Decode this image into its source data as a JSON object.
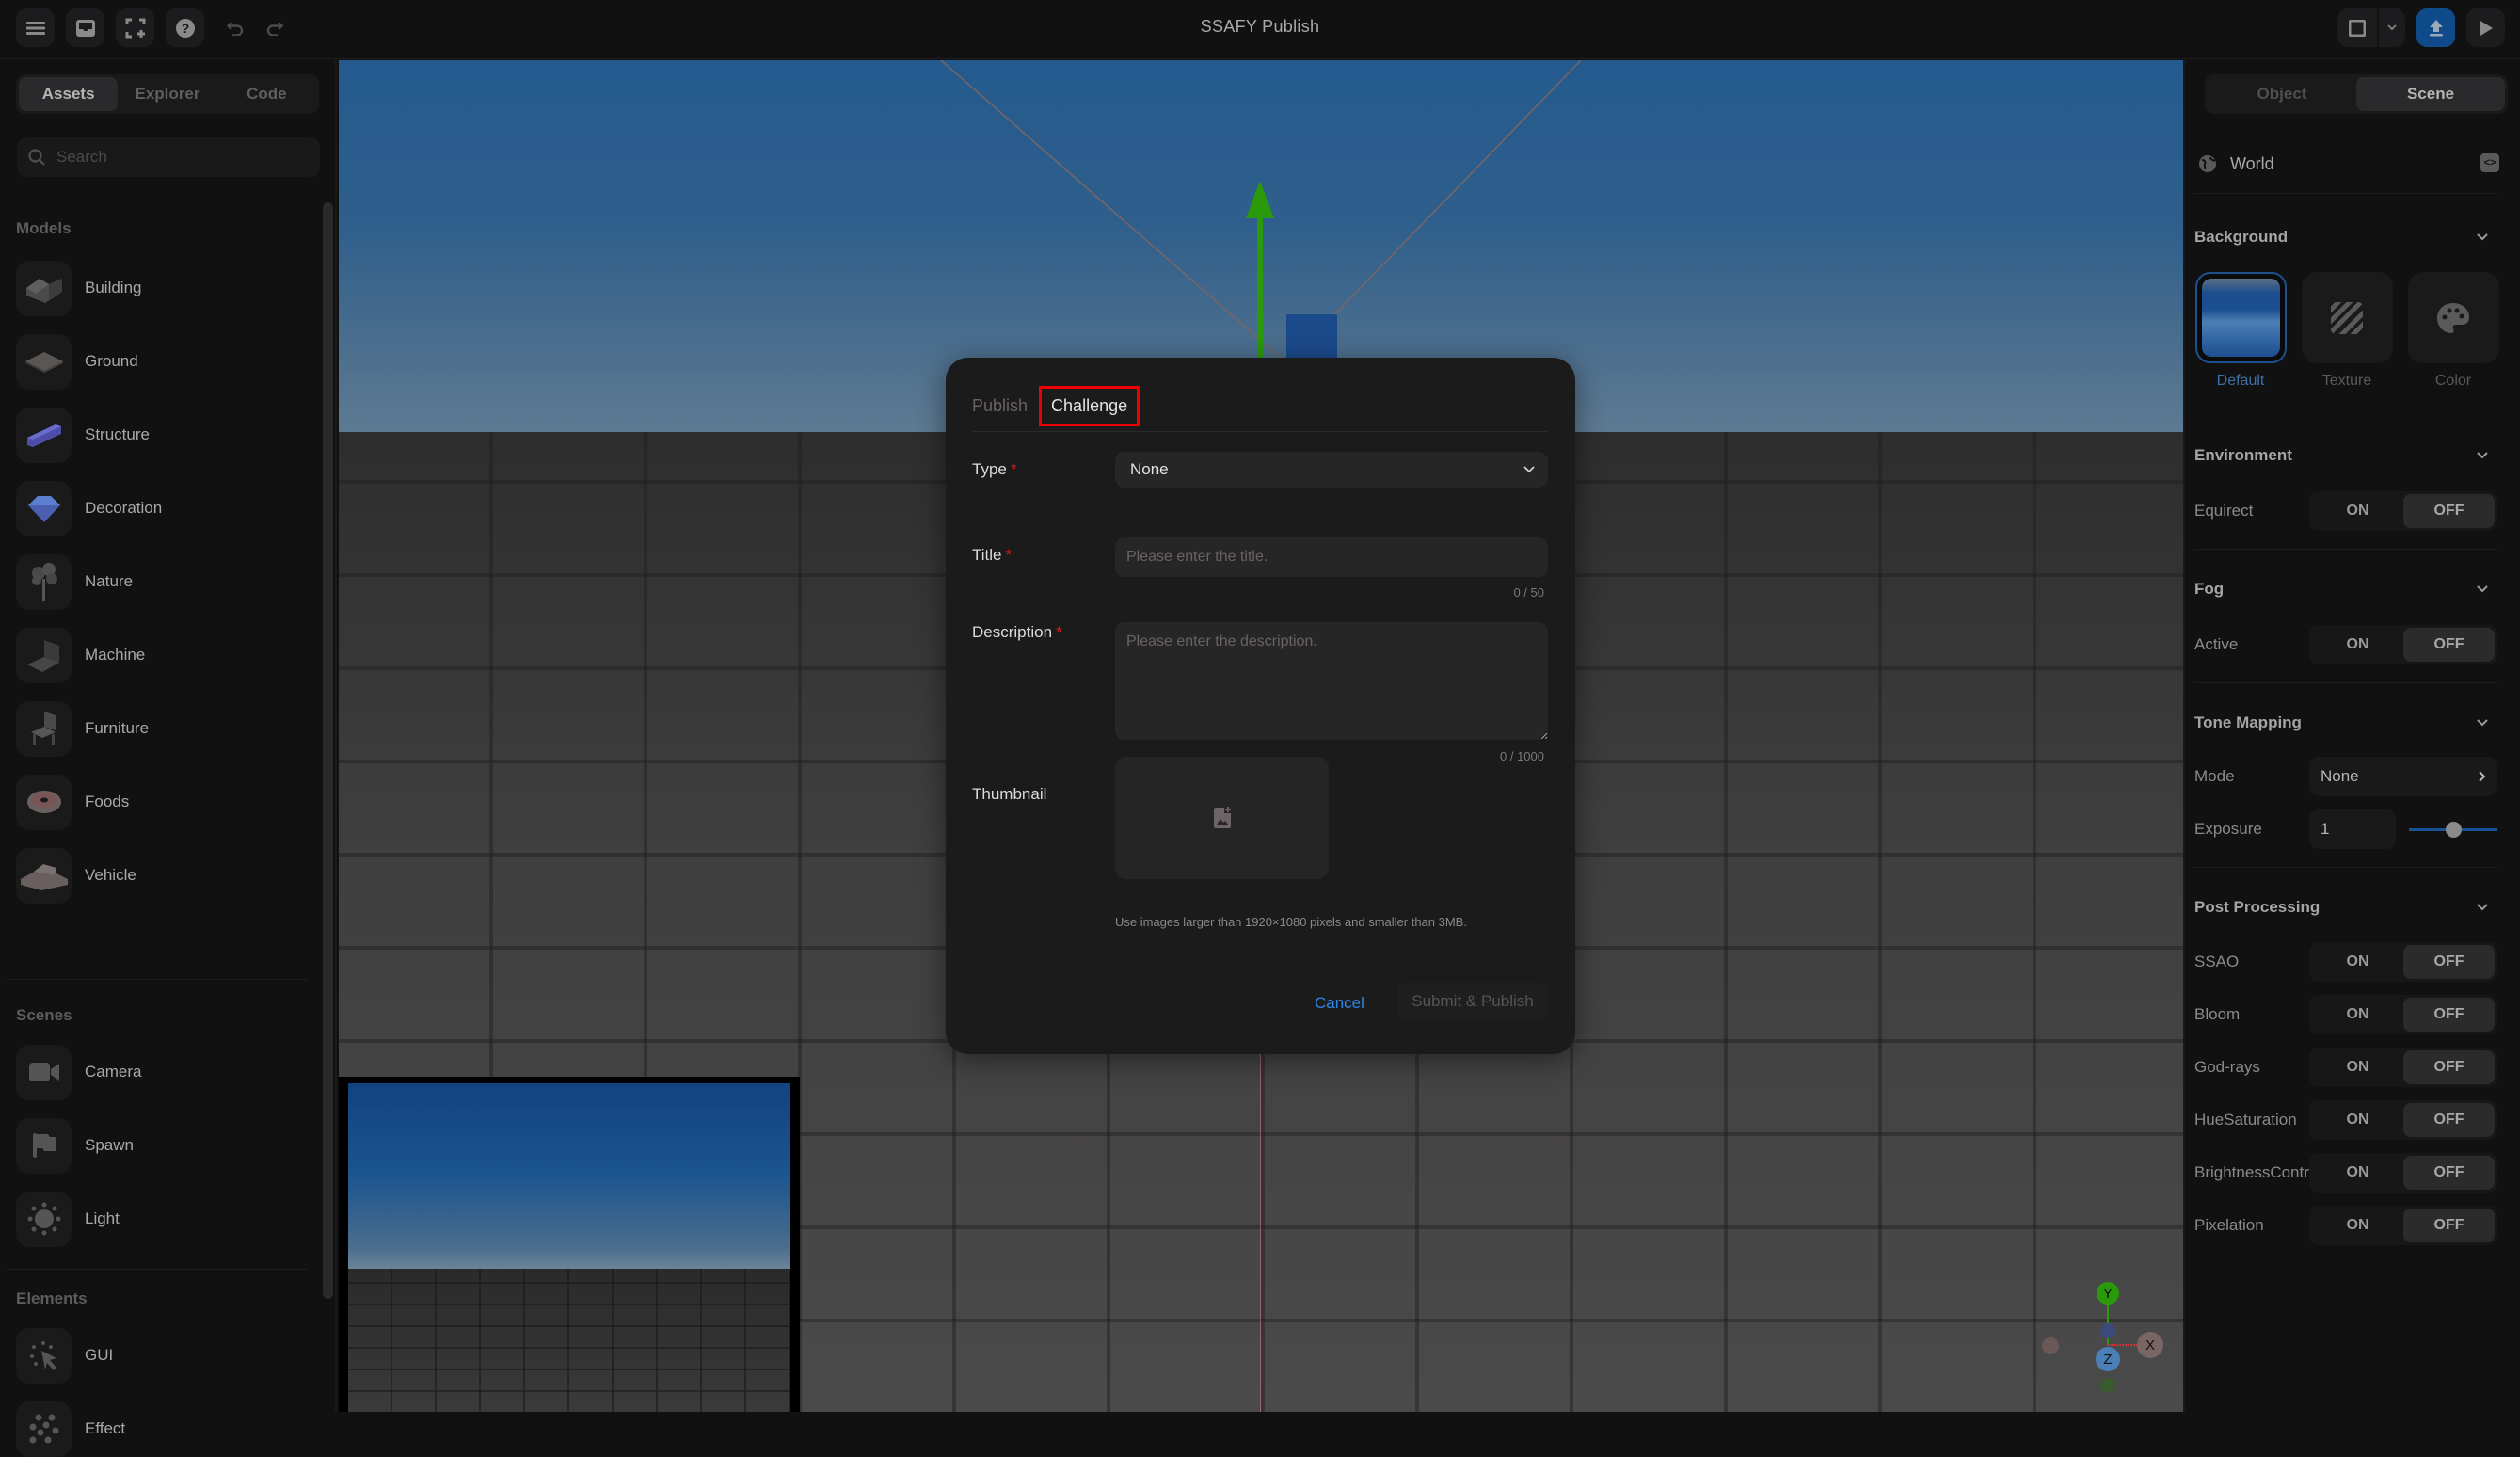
{
  "app": {
    "title": "SSAFY Publish",
    "toolbar_left": [
      {
        "name": "menu-button",
        "icon": "hamburger-icon"
      },
      {
        "name": "inbox-button",
        "icon": "inbox-icon"
      },
      {
        "name": "fullscreen-button",
        "icon": "fullscreen-add-icon"
      },
      {
        "name": "help-button",
        "icon": "help-circle-icon"
      },
      {
        "name": "undo-button",
        "icon": "undo-icon"
      },
      {
        "name": "redo-button",
        "icon": "redo-icon"
      }
    ],
    "toolbar_right": [
      {
        "name": "layout-button",
        "icon": "panel-icon"
      },
      {
        "name": "layout-dropdown",
        "icon": "chevron-down-icon"
      },
      {
        "name": "publish-button",
        "icon": "upload-icon"
      },
      {
        "name": "play-button",
        "icon": "play-icon"
      }
    ]
  },
  "left_panel": {
    "tabs": [
      {
        "label": "Assets",
        "active": true
      },
      {
        "label": "Explorer",
        "active": false
      },
      {
        "label": "Code",
        "active": false
      }
    ],
    "search": {
      "placeholder": "Search",
      "value": ""
    },
    "sections": [
      {
        "title": "Models",
        "items": [
          {
            "label": "Building",
            "icon": "building-icon"
          },
          {
            "label": "Ground",
            "icon": "ground-tile-icon"
          },
          {
            "label": "Structure",
            "icon": "structure-icon"
          },
          {
            "label": "Decoration",
            "icon": "gem-icon"
          },
          {
            "label": "Nature",
            "icon": "tree-icon"
          },
          {
            "label": "Machine",
            "icon": "laptop-icon"
          },
          {
            "label": "Furniture",
            "icon": "chair-icon"
          },
          {
            "label": "Foods",
            "icon": "donut-icon"
          },
          {
            "label": "Vehicle",
            "icon": "car-icon"
          }
        ]
      },
      {
        "title": "Scenes",
        "items": [
          {
            "label": "Camera",
            "icon": "video-camera-icon"
          },
          {
            "label": "Spawn",
            "icon": "flag-icon"
          },
          {
            "label": "Light",
            "icon": "sun-icon"
          }
        ]
      },
      {
        "title": "Elements",
        "items": [
          {
            "label": "GUI",
            "icon": "cursor-click-icon"
          },
          {
            "label": "Effect",
            "icon": "particles-icon"
          }
        ]
      }
    ]
  },
  "viewport": {
    "axis_labels": {
      "y": "Y",
      "z": "Z",
      "x": "X"
    }
  },
  "modal": {
    "tabs": [
      {
        "label": "Publish",
        "active": false
      },
      {
        "label": "Challenge",
        "active": true
      }
    ],
    "fields": {
      "type": {
        "label": "Type",
        "required": "*",
        "value": "None"
      },
      "title": {
        "label": "Title",
        "required": "*",
        "placeholder": "Please enter the title.",
        "value": "",
        "counter": "0 / 50"
      },
      "description": {
        "label": "Description",
        "required": "*",
        "placeholder": "Please enter the description.",
        "value": "",
        "counter": "0 / 1000"
      },
      "thumbnail": {
        "label": "Thumbnail",
        "hint": "Use images larger than 1920×1080 pixels and smaller than 3MB."
      }
    },
    "actions": {
      "cancel": "Cancel",
      "submit": "Submit & Publish"
    },
    "accent_color": "#2c88e6",
    "highlight_color": "#ef0000"
  },
  "right_panel": {
    "tabs": [
      {
        "label": "Object",
        "active": false
      },
      {
        "label": "Scene",
        "active": true
      }
    ],
    "world_label": "World",
    "background": {
      "title": "Background",
      "options": [
        {
          "label": "Default",
          "selected": true
        },
        {
          "label": "Texture",
          "selected": false
        },
        {
          "label": "Color",
          "selected": false
        }
      ]
    },
    "environment": {
      "title": "Environment",
      "rows": [
        {
          "label": "Equirect",
          "on": "ON",
          "off": "OFF",
          "value": "OFF"
        }
      ]
    },
    "fog": {
      "title": "Fog",
      "rows": [
        {
          "label": "Active",
          "on": "ON",
          "off": "OFF",
          "value": "OFF"
        }
      ]
    },
    "tone_mapping": {
      "title": "Tone Mapping",
      "mode_label": "Mode",
      "mode_value": "None",
      "exposure_label": "Exposure",
      "exposure_value": "1",
      "exposure_slider_fraction": 0.5
    },
    "post_processing": {
      "title": "Post Processing",
      "rows": [
        {
          "label": "SSAO",
          "on": "ON",
          "off": "OFF",
          "value": "OFF"
        },
        {
          "label": "Bloom",
          "on": "ON",
          "off": "OFF",
          "value": "OFF"
        },
        {
          "label": "God-rays",
          "on": "ON",
          "off": "OFF",
          "value": "OFF"
        },
        {
          "label": "HueSaturation",
          "on": "ON",
          "off": "OFF",
          "value": "OFF"
        },
        {
          "label": "BrightnessContrast",
          "on": "ON",
          "off": "OFF",
          "value": "OFF"
        },
        {
          "label": "Pixelation",
          "on": "ON",
          "off": "OFF",
          "value": "OFF"
        }
      ]
    }
  }
}
